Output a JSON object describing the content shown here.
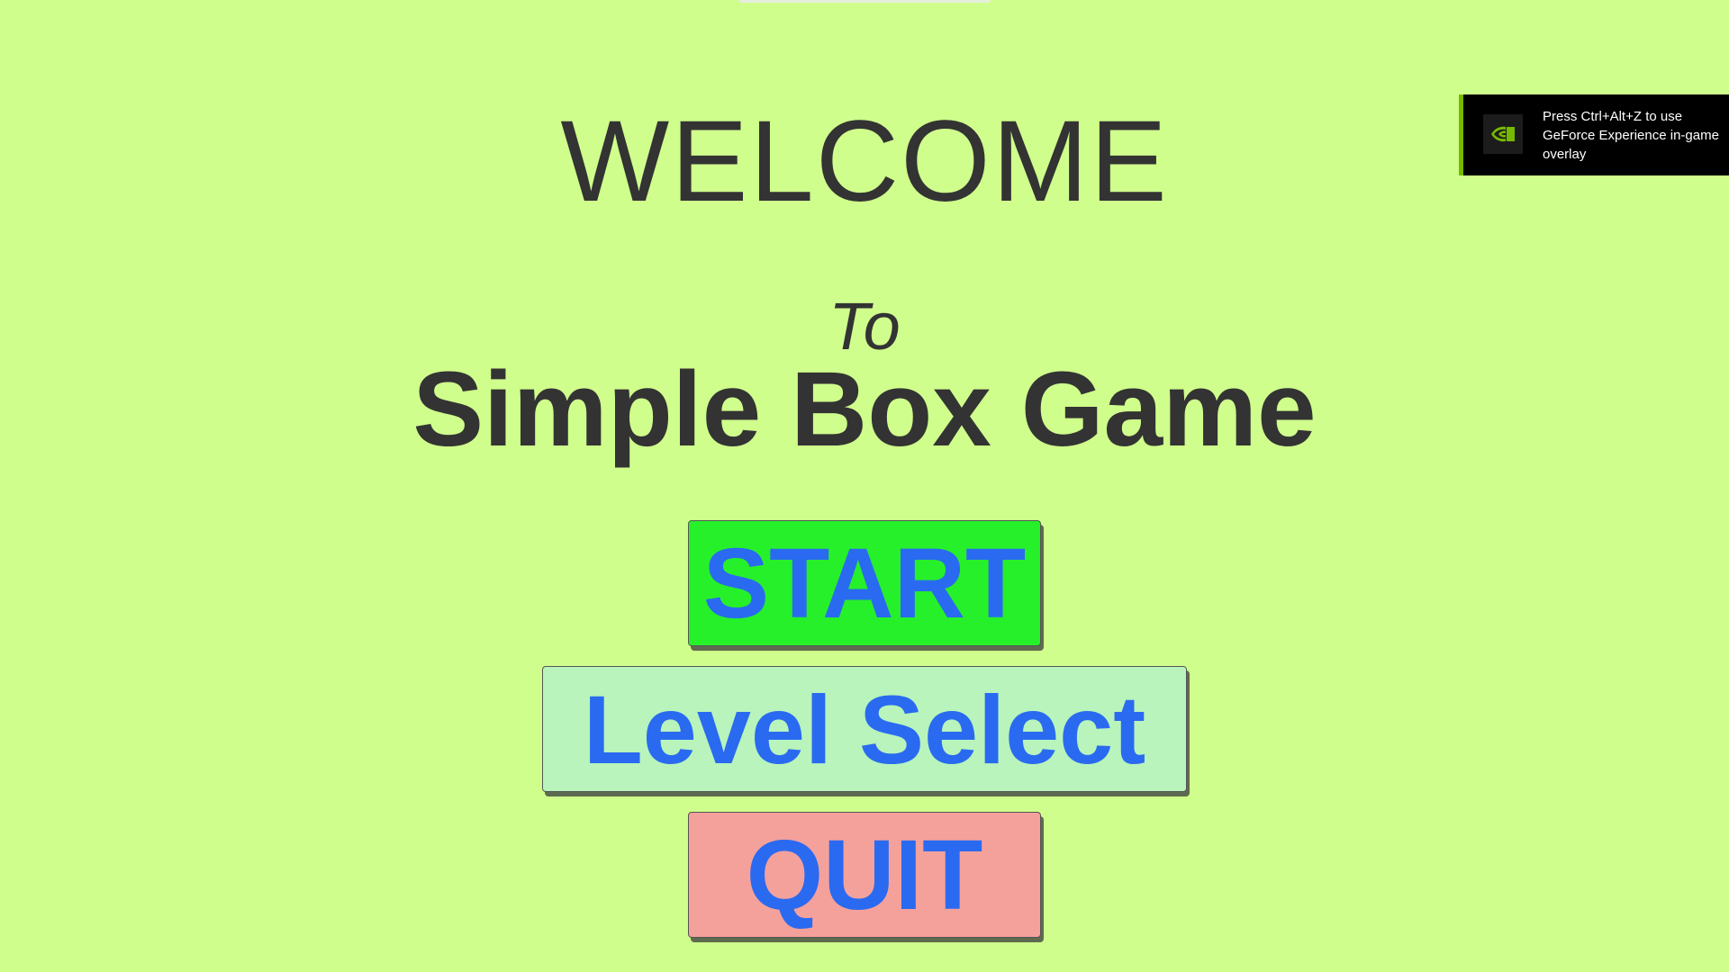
{
  "title": {
    "welcome": "WELCOME",
    "to": "To",
    "game_name": "Simple Box Game"
  },
  "menu": {
    "start_label": "START",
    "level_select_label": "Level Select",
    "quit_label": "QUIT"
  },
  "overlay": {
    "message": "Press Ctrl+Alt+Z to use GeForce Experience in-game overlay",
    "icon": "nvidia-logo-icon"
  },
  "colors": {
    "background": "#d0fe8c",
    "title_text": "#333333",
    "button_text": "#2a6af0",
    "start_button": "#26f02a",
    "level_select_button": "#b8f4bc",
    "quit_button": "#f4a19c",
    "overlay_accent": "#76b900"
  }
}
